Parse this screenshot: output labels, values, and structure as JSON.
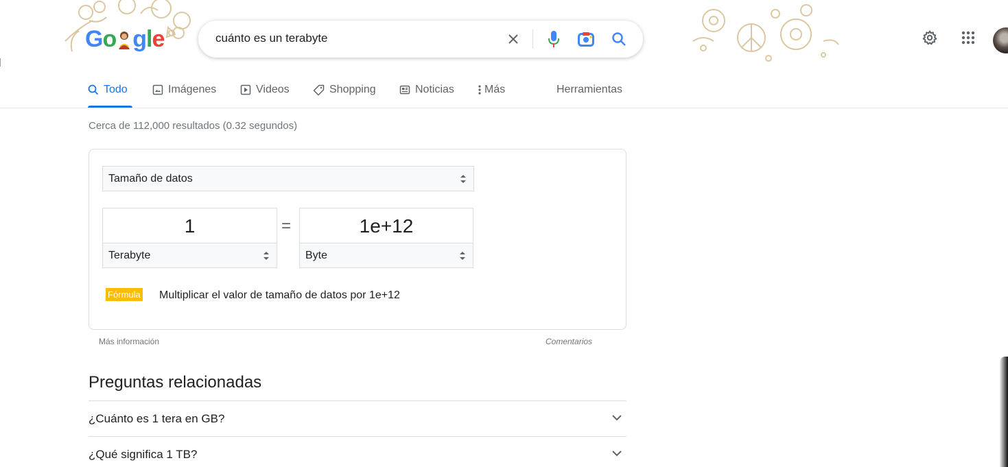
{
  "search": {
    "query": "cuánto es un terabyte"
  },
  "logo": {
    "letters": [
      "G",
      "o",
      "",
      "g",
      "l",
      "e"
    ],
    "colors": [
      "#4285f4",
      "#34a853",
      "",
      "#4285f4",
      "#34a853",
      "#ea4335"
    ]
  },
  "tabs": [
    {
      "label": "Todo",
      "icon": "search-icon"
    },
    {
      "label": "Imágenes",
      "icon": "image-icon"
    },
    {
      "label": "Videos",
      "icon": "play-icon"
    },
    {
      "label": "Shopping",
      "icon": "tag-icon"
    },
    {
      "label": "Noticias",
      "icon": "news-icon"
    },
    {
      "label": "Más",
      "icon": "more-vert-icon"
    },
    {
      "label": "Herramientas",
      "icon": ""
    }
  ],
  "results": {
    "stats": "Cerca de 112,000 resultados (0.32 segundos)"
  },
  "converter": {
    "category": "Tamaño de datos",
    "from_value": "1",
    "from_unit": "Terabyte",
    "equals": "=",
    "to_value": "1e+12",
    "to_unit": "Byte",
    "formula_label": "Fórmula",
    "formula_text": "Multiplicar el valor de tamaño de datos por 1e+12",
    "more_info": "Más información",
    "feedback": "Comentarios"
  },
  "related": {
    "title": "Preguntas relacionadas",
    "questions": [
      "¿Cuánto es 1 tera en GB?",
      "¿Qué significa 1 TB?"
    ]
  },
  "colors": {
    "accent": "#1a73e8",
    "formula_badge": "#fbbc04",
    "mic_blue": "#4285f4",
    "mic_red": "#ea4335",
    "lens_yellow": "#fbbc04"
  }
}
